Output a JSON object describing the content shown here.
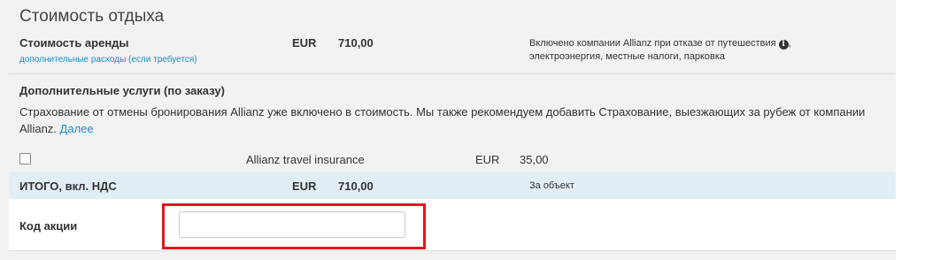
{
  "section_title": "Стоимость отдыха",
  "rental": {
    "label": "Стоимость аренды",
    "extra_link": "дополнительные расходы (если требуется)",
    "currency": "EUR",
    "amount": "710,00",
    "note_line1": "Включено компании Allianz при отказе от путешествия",
    "note_line1_suffix": ",",
    "note_line2": "электроэнергия, местные налоги, парковка",
    "info_glyph": "i"
  },
  "extras": {
    "title": "Дополнительные услуги (по заказу)",
    "description": "Страхование от отмены бронирования Allianz  уже включено в стоимость. Мы также рекомендуем добавить Страхование, выезжающих  за рубеж от компании Allianz.",
    "more_link": "Далее",
    "insurance": {
      "name": "Allianz travel insurance",
      "currency": "EUR",
      "price": "35,00",
      "checked": false
    }
  },
  "total": {
    "label": "ИТОГО, вкл. НДС",
    "currency": "EUR",
    "amount": "710,00",
    "note": "За объект"
  },
  "promo": {
    "label": "Код акции",
    "value": "",
    "placeholder": ""
  },
  "colors": {
    "link": "#1a8bc6",
    "total_row_bg": "#e2eef5",
    "highlight_border": "#e0161e",
    "panel_bg": "#f2f2f2"
  }
}
